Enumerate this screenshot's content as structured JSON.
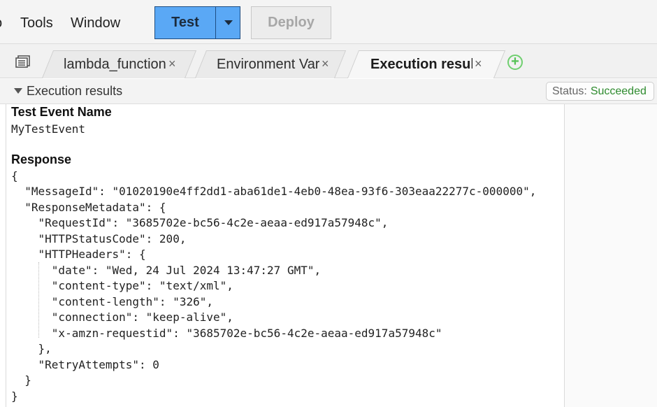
{
  "menubar": {
    "partial_label": "o",
    "tools_label": "Tools",
    "window_label": "Window",
    "test_label": "Test",
    "deploy_label": "Deploy"
  },
  "tabs": [
    {
      "label": "lambda_function.",
      "close": "×",
      "active": false
    },
    {
      "label": "Environment Vari",
      "close": "×",
      "active": false
    },
    {
      "label": "Execution results",
      "close": "×",
      "active": true
    }
  ],
  "add_tab_label": "+",
  "section": {
    "title": "Execution results",
    "status_label": "Status:",
    "status_value": "Succeeded"
  },
  "results": {
    "event_heading": "Test Event Name",
    "event_name": "MyTestEvent",
    "response_heading": "Response",
    "response_lines": [
      "{",
      "  \"MessageId\": \"01020190e4ff2dd1-aba61de1-4eb0-48ea-93f6-303eaa22277c-000000\",",
      "  \"ResponseMetadata\": {",
      "    \"RequestId\": \"3685702e-bc56-4c2e-aeaa-ed917a57948c\",",
      "    \"HTTPStatusCode\": 200,",
      "    \"HTTPHeaders\": {",
      "      \"date\": \"Wed, 24 Jul 2024 13:47:27 GMT\",",
      "      \"content-type\": \"text/xml\",",
      "      \"content-length\": \"326\",",
      "      \"connection\": \"keep-alive\",",
      "      \"x-amzn-requestid\": \"3685702e-bc56-4c2e-aeaa-ed917a57948c\"",
      "    },",
      "    \"RetryAttempts\": 0",
      "  }",
      "}"
    ]
  },
  "colors": {
    "test_button": "#5aa8f5",
    "status_success": "#2e8b2e",
    "add_tab": "#55c255"
  }
}
